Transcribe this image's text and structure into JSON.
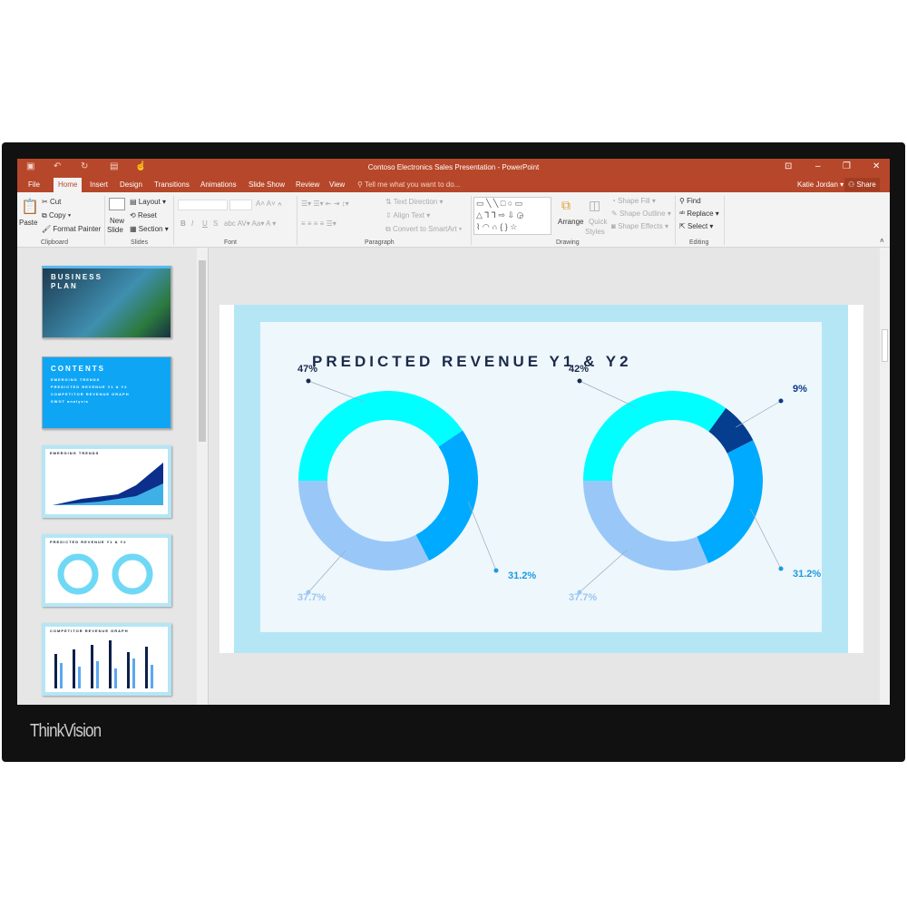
{
  "window": {
    "title": "Contoso Electronics Sales Presentation - PowerPoint",
    "user": "Katie Jordan",
    "share": "Share"
  },
  "tabs": [
    "File",
    "Home",
    "Insert",
    "Design",
    "Transitions",
    "Animations",
    "Slide Show",
    "Review",
    "View"
  ],
  "tell_me": "Tell me what you want to do...",
  "ribbon": {
    "clipboard": {
      "paste": "Paste",
      "cut": "Cut",
      "copy": "Copy",
      "format_painter": "Format Painter",
      "label": "Clipboard"
    },
    "slides": {
      "new_slide": "New",
      "new_slide2": "Slide",
      "layout": "Layout",
      "reset": "Reset",
      "section": "Section",
      "label": "Slides"
    },
    "font": {
      "label": "Font",
      "bold": "B",
      "italic": "I",
      "underline": "U",
      "strike": "S"
    },
    "paragraph": {
      "text_direction": "Text Direction",
      "align_text": "Align Text",
      "convert": "Convert to SmartArt",
      "label": "Paragraph"
    },
    "drawing": {
      "arrange": "Arrange",
      "quick": "Quick",
      "styles": "Styles",
      "shape_fill": "Shape Fill",
      "shape_outline": "Shape Outline",
      "shape_effects": "Shape Effects",
      "label": "Drawing"
    },
    "editing": {
      "find": "Find",
      "replace": "Replace",
      "select": "Select",
      "label": "Editing"
    }
  },
  "thumbnails": [
    {
      "title": "BUSINESS",
      "title2": "PLAN"
    },
    {
      "title": "CONTENTS",
      "lines": [
        "EMERGING TRENDS",
        "PREDICTED REVENUE Y1 & Y2",
        "COMPETITOR REVENUE GRAPH",
        "SWOT analysis"
      ]
    },
    {
      "title": "EMERGING TRENDS"
    },
    {
      "title": "PREDICTED REVENUE Y1 & Y2"
    },
    {
      "title": "COMPETITOR REVENUE GRAPH"
    }
  ],
  "slide": {
    "title": "PREDICTED REVENUE Y1 & Y2"
  },
  "chart_data": [
    {
      "type": "pie",
      "donut": true,
      "slices": [
        {
          "label": "47%",
          "value": 47,
          "color": "#00ffff"
        },
        {
          "label": "31.2%",
          "value": 31.2,
          "color": "#00aaff"
        },
        {
          "label": "37.7%",
          "value": 37.7,
          "color": "#99c8f8"
        }
      ]
    },
    {
      "type": "pie",
      "donut": true,
      "slices": [
        {
          "label": "42%",
          "value": 42,
          "color": "#00ffff"
        },
        {
          "label": "9%",
          "value": 9,
          "color": "#053d8f"
        },
        {
          "label": "31.2%",
          "value": 31.2,
          "color": "#00aaff"
        },
        {
          "label": "37.7%",
          "value": 37.7,
          "color": "#99c8f8"
        }
      ]
    }
  ],
  "brand": {
    "logo": "ThinkVision"
  }
}
